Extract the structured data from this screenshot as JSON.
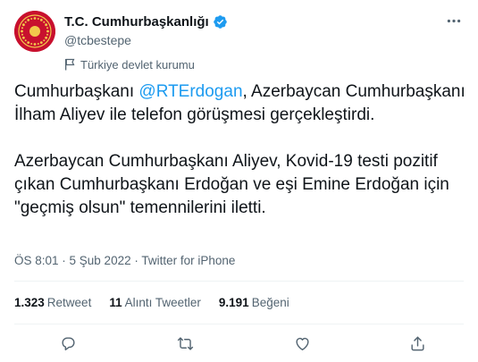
{
  "account": {
    "display_name": "T.C. Cumhurbaşkanlığı",
    "handle": "@tcbestepe",
    "label": "Türkiye devlet kurumu",
    "verified": true,
    "avatar_color": "#c8102e"
  },
  "tweet": {
    "paragraph1": {
      "prefix": "Cumhurbaşkanı ",
      "mention": "@RTErdogan",
      "suffix": ", Azerbaycan Cumhurbaşkanı İlham Aliyev ile telefon görüşmesi gerçekleştirdi."
    },
    "paragraph2": "Azerbaycan Cumhurbaşkanı Aliyev, Kovid-19 testi pozitif çıkan Cumhurbaşkanı Erdoğan ve eşi Emine Erdoğan için \"geçmiş olsun\" temennilerini iletti."
  },
  "meta": {
    "time": "ÖS 8:01",
    "separator": " · ",
    "date": "5 Şub 2022",
    "source": "Twitter for iPhone"
  },
  "stats": {
    "retweets": {
      "count": "1.323",
      "label": "Retweet"
    },
    "quotes": {
      "count": "11",
      "label": "Alıntı Tweetler"
    },
    "likes": {
      "count": "9.191",
      "label": "Beğeni"
    }
  },
  "actions": [
    "reply-icon",
    "retweet-icon",
    "like-icon",
    "share-icon"
  ],
  "colors": {
    "accent": "#1d9bf0",
    "text": "#0f1419",
    "secondary": "#536471",
    "divider": "#eff3f4"
  }
}
